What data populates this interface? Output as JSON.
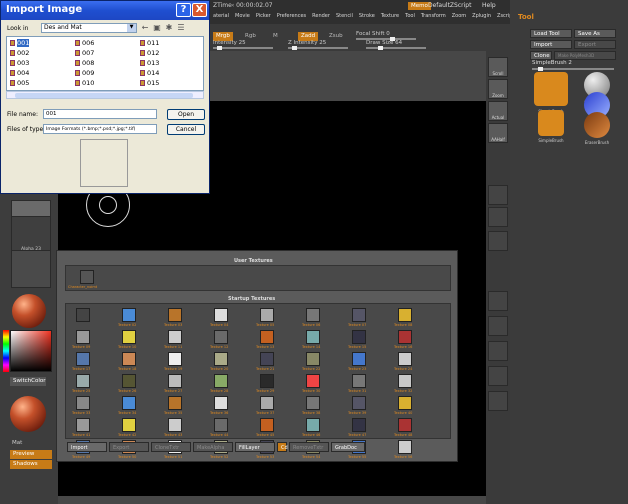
{
  "zbrush": {
    "title": "ZTime‹ 00:00:02.07",
    "menus": [
      "aterial",
      "Movie",
      "Picker",
      "Preferences",
      "Render",
      "Stencil",
      "Stroke",
      "Texture",
      "Tool",
      "Transform",
      "Zoom",
      "Zplugin",
      "Zscript"
    ],
    "memo": "Memo",
    "script": "DefaultZScript",
    "help": "Help",
    "mrgb": "Mrgb",
    "rgb": "Rgb",
    "m": "M",
    "zadd": "Zadd",
    "zsub": "Zsub",
    "focal_shift": "Focal Shift 0",
    "intensity": "Intensity 25",
    "z_intensity": "Z Intensity 25",
    "draw_size": "Draw Size 64",
    "left": {
      "sel_label": "",
      "alpha_label": "Alpha 23",
      "switchcolor": "SwitchColor",
      "mat_label": "Mat",
      "preview": "Preview",
      "shadows": "Shadows"
    },
    "shelf": [
      "Scroll",
      "Zoom",
      "Actual",
      "AAHalf"
    ],
    "tool_panel": {
      "title": "Tool",
      "load": "Load Tool",
      "save": "Save As",
      "import": "Import",
      "export": "Export",
      "clone": "Clone",
      "make_poly": "Make PolyMesh3D",
      "simple_brush": "SimpleBrush 2",
      "brushes": [
        "SimpleBrush",
        "SphereBrush",
        "AlphaBrush",
        "SimpleBrush",
        "EraserBrush"
      ]
    }
  },
  "texture_palette": {
    "user_title": "User Textures",
    "user_item": "Character_noimt",
    "startup_title": "Startup Textures",
    "labels": [
      "",
      "Texture 02",
      "Texture 03",
      "Texture 04",
      "Texture 05",
      "Texture 06",
      "Texture 07",
      "Texture 08",
      "Texture 09",
      "Texture 10",
      "Texture 11",
      "Texture 12",
      "Texture 13",
      "Texture 14",
      "Texture 15",
      "Texture 16",
      "Texture 17",
      "Texture 18",
      "Texture 19",
      "Texture 20",
      "Texture 21",
      "Texture 22",
      "Texture 23",
      "Texture 24",
      "Texture 25",
      "Texture 26",
      "Texture 27",
      "Texture 28",
      "Texture 29",
      "Texture 30",
      "Texture 31",
      "Texture 32",
      "Texture 33",
      "Texture 34",
      "Texture 35",
      "Texture 36",
      "Texture 37",
      "Texture 38",
      "Texture 39",
      "Texture 40",
      "Texture 41",
      "Texture 42",
      "Texture 43",
      "Texture 44",
      "Texture 45",
      "Texture 46",
      "Texture 47",
      "Texture 48",
      "Texture 49",
      "Texture 50",
      "Texture 51",
      "Texture 52",
      "Texture 53",
      "Texture 54",
      "Texture 55",
      "Texture 56"
    ],
    "buttons": {
      "import": "Import",
      "export": "Export",
      "clone": "CloneTxtr",
      "make_alpha": "MakeAlpha",
      "fill_layer": "FillLayer",
      "cd": "Cd",
      "remove": "RemoveTxtr",
      "grab_doc": "GrabDoc"
    }
  },
  "dialog": {
    "title": "Import Image",
    "help_glyph": "?",
    "close_glyph": "X",
    "look_in_label": "Look in",
    "look_in_value": "Des and Mat",
    "files": [
      "001",
      "002",
      "003",
      "004",
      "005",
      "006",
      "007",
      "008",
      "009",
      "010",
      "011",
      "012",
      "013",
      "014",
      "015"
    ],
    "file_name_label": "File name:",
    "file_name_value": "001",
    "file_type_label": "Files of type:",
    "file_type_value": "Image Formats (*.bmp;*.psd;*.jpg;*.tif)",
    "open": "Open",
    "cancel": "Cancel"
  }
}
